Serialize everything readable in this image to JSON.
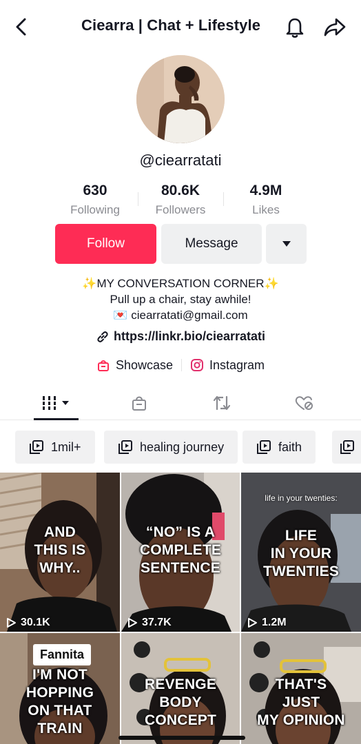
{
  "header": {
    "title": "Ciearra | Chat + Lifestyle",
    "back_icon": "chevron-left-icon",
    "bell_icon": "bell-icon",
    "share_icon": "share-arrow-icon"
  },
  "profile": {
    "username": "@ciearratati",
    "avatar_icon": "profile-photo"
  },
  "stats": [
    {
      "value": "630",
      "label": "Following"
    },
    {
      "value": "80.6K",
      "label": "Followers"
    },
    {
      "value": "4.9M",
      "label": "Likes"
    }
  ],
  "actions": {
    "follow_label": "Follow",
    "message_label": "Message",
    "more_icon": "caret-down-icon"
  },
  "bio": {
    "line1": "✨MY CONVERSATION CORNER✨",
    "line2": "Pull up a chair, stay awhile!",
    "line3": "💌 ciearratati@gmail.com",
    "link": "https://linkr.bio/ciearratati"
  },
  "shortcuts": {
    "showcase_label": "Showcase",
    "instagram_label": "Instagram"
  },
  "tabs": [
    {
      "name": "videos",
      "icon": "grid-lines-icon",
      "active": true
    },
    {
      "name": "shop",
      "icon": "shopping-bag-icon",
      "active": false
    },
    {
      "name": "reposts",
      "icon": "repost-icon",
      "active": false
    },
    {
      "name": "liked",
      "icon": "liked-heart-hidden-icon",
      "active": false
    }
  ],
  "playlists": [
    "1mil+",
    "healing journey",
    "faith",
    ""
  ],
  "videos": [
    {
      "overlay": "AND\nTHIS IS\nWHY..",
      "views": "30.1K",
      "top_caption": ""
    },
    {
      "overlay": "“NO” IS A\nCOMPLETE\nSENTENCE",
      "views": "37.7K",
      "top_caption": ""
    },
    {
      "overlay": "LIFE\nIN YOUR\nTWENTIES",
      "views": "1.2M",
      "top_caption": "life in your twenties:"
    },
    {
      "overlay": "I'M NOT\nHOPPING\nON THAT\nTRAIN",
      "views": "",
      "top_caption": "",
      "badge": "Fannita"
    },
    {
      "overlay": "REVENGE\nBODY\nCONCEPT",
      "views": "",
      "top_caption": ""
    },
    {
      "overlay": "THAT'S\nJUST\nMY OPINION",
      "views": "",
      "top_caption": ""
    }
  ],
  "colors": {
    "follow": "#fe2c55",
    "secondary_button": "#eff0f1",
    "muted_text": "#8a8b91"
  }
}
